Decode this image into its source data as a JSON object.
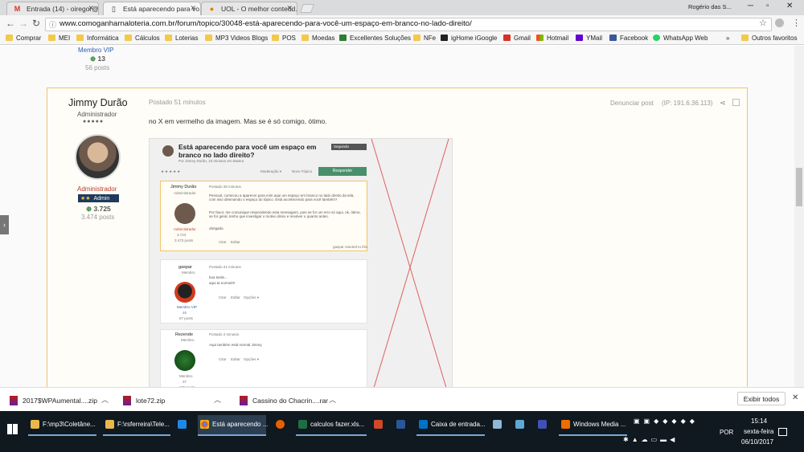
{
  "browser": {
    "tabs": [
      {
        "icon": "gmail-icon",
        "label": "Entrada (14) - oiregor@..."
      },
      {
        "icon": "page-icon",
        "label": "Está aparecendo para vo..."
      },
      {
        "icon": "uol-icon",
        "label": "UOL - O melhor conteúd..."
      }
    ],
    "user_chip": "Rogério das S...",
    "url": "www.comoganharnaloteria.com.br/forum/topico/30048-está-aparecendo-para-você-um-espaço-em-branco-no-lado-direito/",
    "bookmarks": [
      "Comprar",
      "MEI",
      "Informática",
      "Cálculos",
      "Loterias",
      "MP3 Videos Blogs",
      "POS",
      "Moedas",
      "Excellentes Soluções",
      "NFe",
      "igHome iGoogle",
      "Gmail",
      "Hotmail",
      "YMail",
      "Facebook",
      "WhatsApp Web"
    ],
    "bookmarks_more": "»",
    "other_bookmarks": "Outros favoritos"
  },
  "prev_post": {
    "role": "Membro VIP",
    "points": "13",
    "posts": "56 posts"
  },
  "post": {
    "author": "Jimmy Durão",
    "role": "Administrador",
    "stars": "●●●●●",
    "group": "Administrador",
    "points": "3.725",
    "posts": "3.474 posts",
    "posted": "Postado 51 minutos",
    "report": "Denunciar post",
    "ip": "(IP: 191.6.36.113)",
    "body": "no X em vermelho da imagem. Mas se é só comigo, ótimo."
  },
  "screenshot": {
    "title": "Está aparecendo para você um espaço em branco no lado direito?",
    "byline": "Por Jimmy Durão, 23 minutos em Batera",
    "follow": "Seguindo",
    "moderation": "Moderação ▾",
    "new_topic": "Novo Tópico",
    "reply": "Responder",
    "p1_author": "Jimmy Durão",
    "p1_role": "Administrador",
    "p1_time": "Postado 28 minutos",
    "p1_text1": "Pessoal, comecou a aparecer para mim aqui um espaço em branco no lado direito da tela, com isso diminuindo o espaço do tópico. Está acontecendo para você também?",
    "p1_text2": "Por favor, me comunique respondendo esta mensagem, pois se for um erro só aqui, ok, ótimo, se for geral, tenho que investigar o motivo disso e resolver o quanto antes.",
    "p1_text3": "obrigado.",
    "p1_group": "Administrador",
    "p1_points": "3.724",
    "p1_posts": "3.473 posts",
    "p1_likes": "gaspar reacted to this",
    "p2_author": "gaspar",
    "p2_role": "Membro",
    "p2_time": "Postado 21 minutos",
    "p2_text1": "boa tarde...",
    "p2_text2": "aqui ta normal!!!",
    "p2_group": "Membro VIP",
    "p2_points": "46",
    "p2_posts": "67 posts",
    "p3_author": "Rezende",
    "p3_role": "Membro",
    "p3_time": "Postado 2 minutos",
    "p3_text1": "Aqui também está normal Jimmy.",
    "p3_group": "Membro",
    "p3_points": "37",
    "p3_posts": "135 posts",
    "quote": "Citar",
    "edit": "Editar",
    "options": "Opções ▾"
  },
  "downloads": {
    "items": [
      "2017$WPAumental....zip",
      "lote72.zip",
      "Cassino do Chacrin....rar"
    ],
    "show_all": "Exibir todos"
  },
  "taskbar": {
    "items": [
      "F:\\mp3\\Coletâne...",
      "F:\\rsferreira\\Tele...",
      "",
      "Está aparecendo ...",
      "",
      "calculos fazer.xls...",
      "",
      "",
      "Caixa de entrada...",
      "",
      "",
      "",
      "Windows Media ..."
    ],
    "lang": "POR",
    "time": "15:14",
    "day": "sexta-feira",
    "date": "06/10/2017"
  },
  "colors": {
    "accent_red": "#c0392b",
    "admin_blue": "#1f3a5c",
    "reply_green": "#4a8f6b",
    "post_border": "#f0c36a"
  }
}
